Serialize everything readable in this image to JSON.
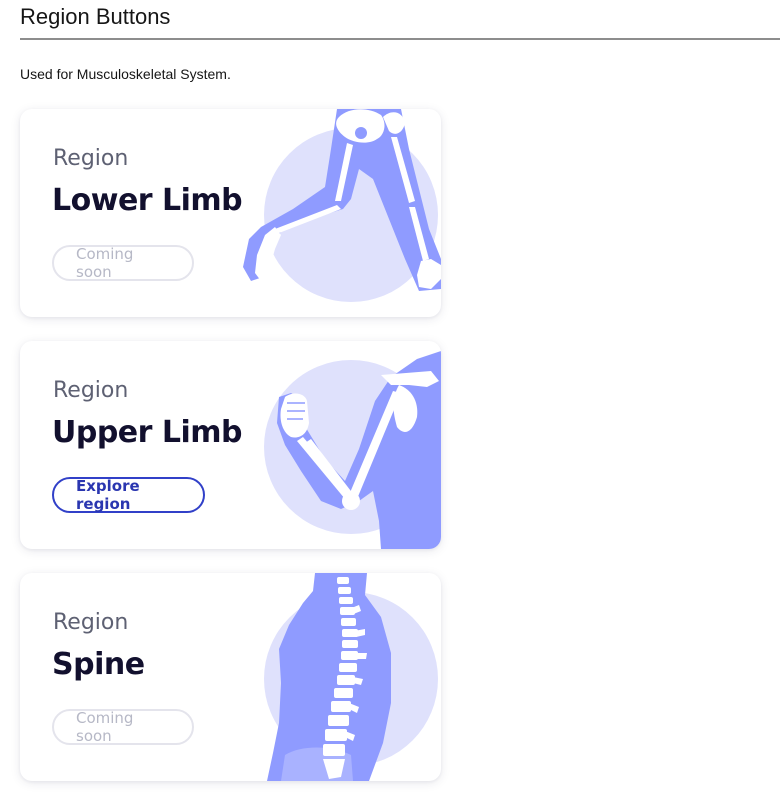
{
  "page": {
    "title": "Region Buttons",
    "description": "Used for Musculoskeletal System."
  },
  "colors": {
    "circle": "#dfe1fc",
    "body_fill": "#8f9bff",
    "bone": "#ffffff",
    "active_button": "#3140c8",
    "disabled_button_text": "#b6b8c6"
  },
  "cards": [
    {
      "eyebrow": "Region",
      "title": "Lower Limb",
      "button_label": "Coming soon",
      "button_state": "disabled",
      "illustration": "lower-limb-skeleton"
    },
    {
      "eyebrow": "Region",
      "title": "Upper Limb",
      "button_label": "Explore region",
      "button_state": "active",
      "illustration": "upper-limb-skeleton"
    },
    {
      "eyebrow": "Region",
      "title": "Spine",
      "button_label": "Coming soon",
      "button_state": "disabled",
      "illustration": "spine-skeleton"
    }
  ]
}
